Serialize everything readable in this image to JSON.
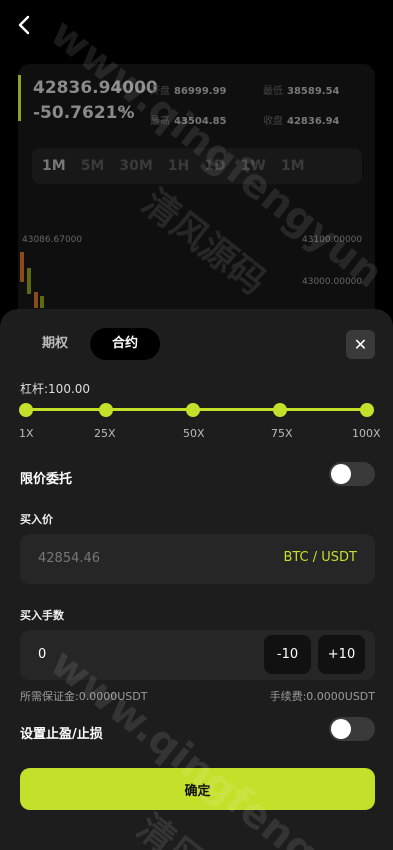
{
  "header": {
    "back_icon": "chevron-left-icon"
  },
  "ticker": {
    "price": "42836.94000",
    "change_pct": "-50.7621%",
    "open_label": "开盘",
    "open_value": "86999.99",
    "low_label": "最低",
    "low_value": "38589.54",
    "high_label": "最高",
    "high_value": "43504.85",
    "close_label": "收盘",
    "close_value": "42836.94",
    "timeframes": [
      "1M",
      "5M",
      "30M",
      "1H",
      "1D",
      "1W",
      "1M"
    ],
    "axis_left": "43086.67000",
    "axis_right_1": "43100.00000",
    "axis_right_2": "43000.00000"
  },
  "watermark": {
    "text_1": "www.qingfengyun",
    "text_2": "清风源码",
    "text_3": "www.qingfeng",
    "text_4": "清风"
  },
  "sheet": {
    "tabs": [
      {
        "label": "期权"
      },
      {
        "label": "合约"
      }
    ],
    "close_label": "✕",
    "leverage_label": "杠杆:100.00",
    "leverage_ticks": [
      "1X",
      "25X",
      "50X",
      "75X",
      "100X"
    ],
    "leverage_value_pct": 100,
    "limit_order_label": "限价委托",
    "limit_order_on": false,
    "buy_price_label": "买入价",
    "buy_price_placeholder": "42854.46",
    "pair": "BTC / USDT",
    "quantity_label": "买入手数",
    "quantity_value": "0",
    "minus_label": "-10",
    "plus_label": "+10",
    "margin_text": "所需保证金:0.0000USDT",
    "fee_text": "手续费:0.0000USDT",
    "stop_label": "设置止盈/止损",
    "stop_on": false,
    "confirm_label": "确定"
  },
  "colors": {
    "accent": "#c5e02b",
    "sheet_bg": "#1d1d1d",
    "field_bg": "#262626"
  }
}
